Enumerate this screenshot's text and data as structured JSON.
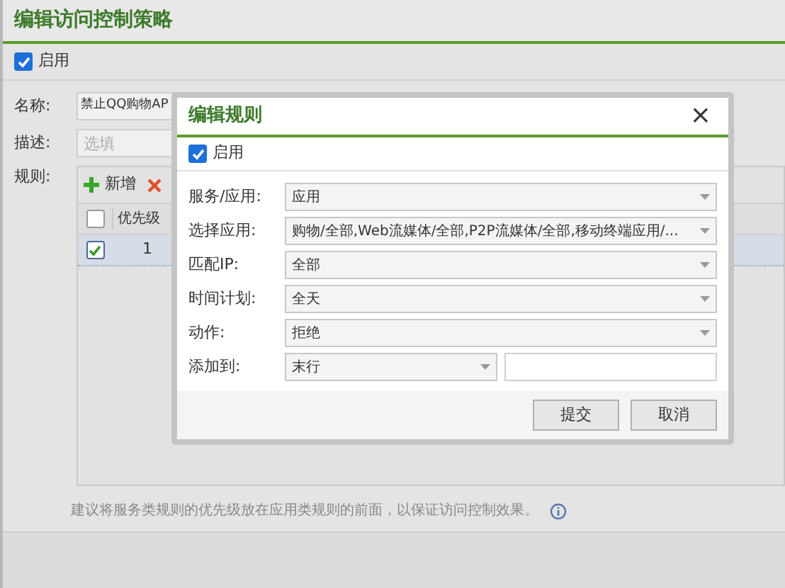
{
  "window": {
    "title": "编辑访问控制策略"
  },
  "enable": {
    "label": "启用",
    "checked": true
  },
  "form": {
    "name_label": "名称:",
    "name_value": "禁止QQ购物AP",
    "desc_label": "描述:",
    "desc_placeholder": "选填",
    "rules_label": "规则:"
  },
  "toolbar": [
    {
      "kind": "add",
      "label": "新增"
    },
    {
      "kind": "delete"
    }
  ],
  "table": {
    "columns": [
      "优先级"
    ],
    "header_checked": false,
    "rows": [
      {
        "checked": true,
        "priority": "1"
      }
    ]
  },
  "hint": "建议将服务类规则的优先级放在应用类规则的前面，以保证访问控制效果。",
  "modal": {
    "title": "编辑规则",
    "close": "×",
    "enable": {
      "label": "启用",
      "checked": true
    },
    "fields": [
      {
        "kind": "select",
        "label": "服务/应用:",
        "value": "应用"
      },
      {
        "kind": "select",
        "label": "选择应用:",
        "value": "购物/全部,Web流媒体/全部,P2P流媒体/全部,移动终端应用/..."
      },
      {
        "kind": "select",
        "label": "匹配IP:",
        "value": "全部"
      },
      {
        "kind": "select",
        "label": "时间计划:",
        "value": "全天"
      },
      {
        "kind": "select",
        "label": "动作:",
        "value": "拒绝"
      },
      {
        "kind": "select_input",
        "label": "添加到:",
        "value": "末行"
      }
    ],
    "buttons": [
      "提交",
      "取消"
    ]
  }
}
